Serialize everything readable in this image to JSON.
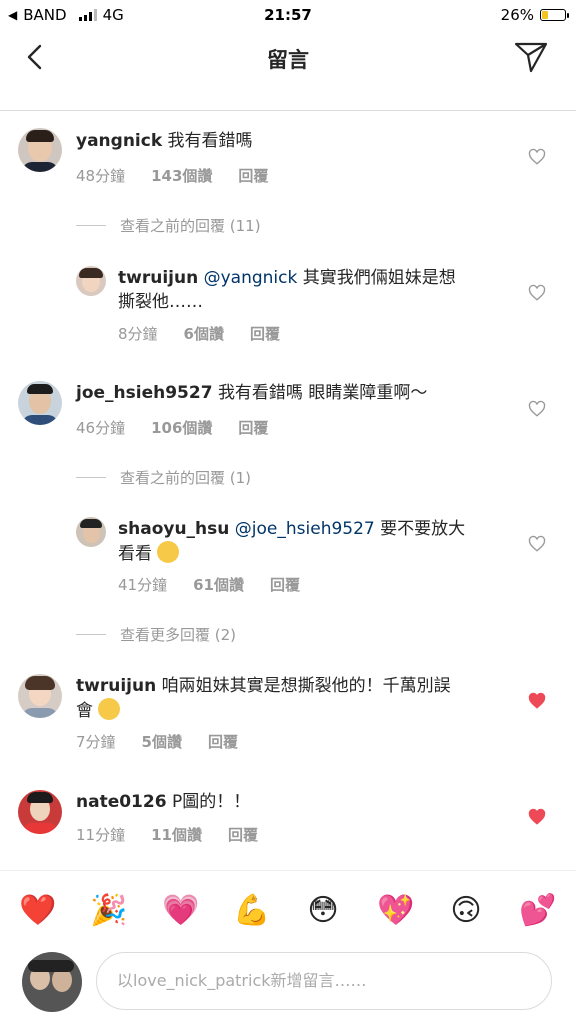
{
  "status_bar": {
    "back_app": "BAND",
    "carrier": "4G",
    "time": "21:57",
    "battery": "26%",
    "battery_level": 0.26
  },
  "header": {
    "title": "留言"
  },
  "comments": [
    {
      "user": "yangnick",
      "text": "我有看錯嗎",
      "time": "48分鐘",
      "likes": "143個讚",
      "reply": "回覆",
      "liked": false
    },
    {
      "viewmore": "查看之前的回覆 (11)"
    },
    {
      "user": "twruijun",
      "mention": "@yangnick",
      "text": "其實我們倆姐妹是想",
      "text2": "撕裂他……",
      "time": "8分鐘",
      "likes": "6個讚",
      "reply": "回覆",
      "liked": false
    },
    {
      "user": "joe_hsieh9527",
      "text": "我有看錯嗎 眼睛業障重啊～",
      "time": "46分鐘",
      "likes": "106個讚",
      "reply": "回覆",
      "liked": false
    },
    {
      "viewmore": "查看之前的回覆 (1)"
    },
    {
      "user": "shaoyu_hsu",
      "mention": "@joe_hsieh9527",
      "text": "要不要放大",
      "text2": "看看",
      "time": "41分鐘",
      "likes": "61個讚",
      "reply": "回覆",
      "liked": false
    },
    {
      "viewmore": "查看更多回覆 (2)"
    },
    {
      "user": "twruijun",
      "text": "咱兩姐妹其實是想撕裂他的！千萬別誤",
      "text2": "會",
      "time": "7分鐘",
      "likes": "5個讚",
      "reply": "回覆",
      "liked": true
    },
    {
      "user": "nate0126",
      "text": "P圖的！！",
      "time": "11分鐘",
      "likes": "11個讚",
      "reply": "回覆",
      "liked": true
    }
  ],
  "emoji_bar": [
    "❤️",
    "🎉",
    "💗",
    "💪",
    "😳",
    "💖",
    "🙃",
    "💕"
  ],
  "input": {
    "placeholder": "以love_nick_patrick新增留言……"
  },
  "colors": {
    "liked_heart": "#ed4956",
    "meta_gray": "#999999",
    "mention_blue": "#003569"
  }
}
